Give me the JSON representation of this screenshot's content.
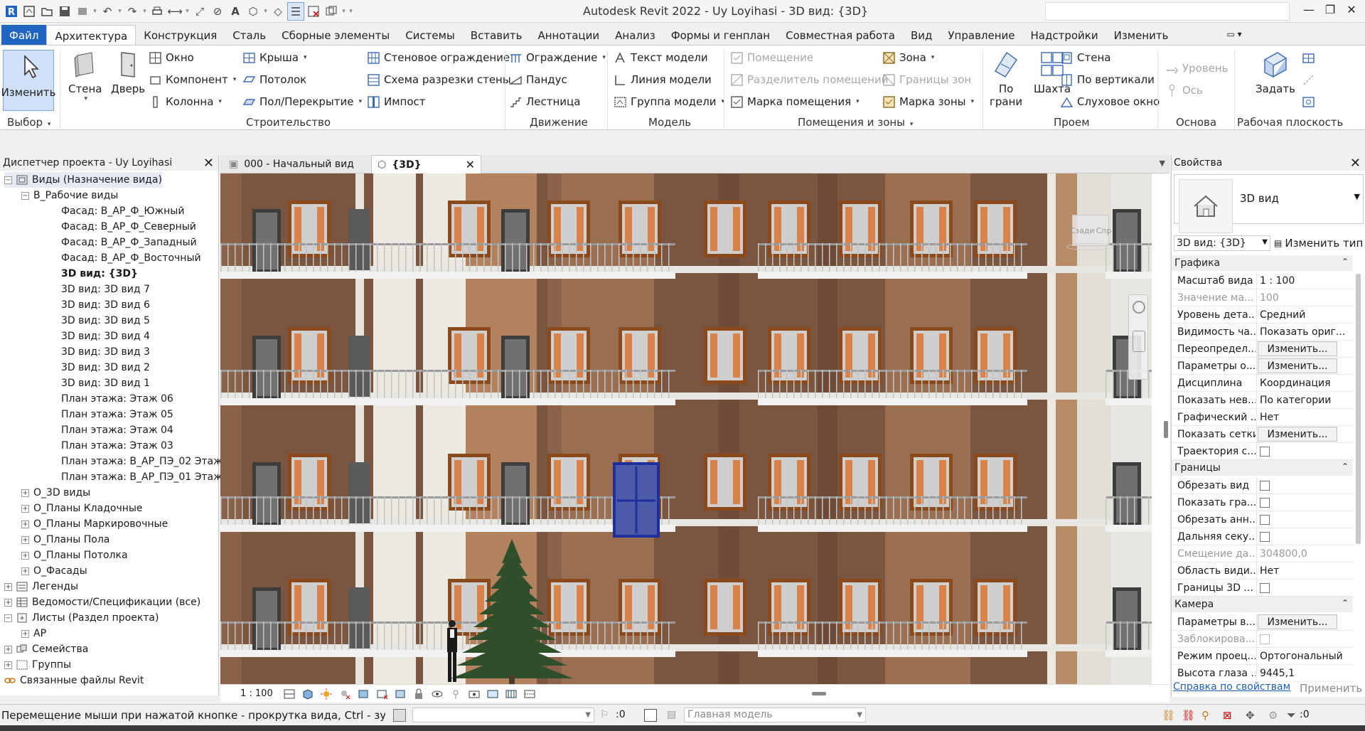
{
  "titlebar": {
    "title": "Autodesk Revit 2022 - Uy Loyihasi - 3D вид: {3D}"
  },
  "ribbon_tabs": [
    "Файл",
    "Архитектура",
    "Конструкция",
    "Сталь",
    "Сборные элементы",
    "Системы",
    "Вставить",
    "Аннотации",
    "Анализ",
    "Формы и генплан",
    "Совместная работа",
    "Вид",
    "Управление",
    "Надстройки",
    "Изменить"
  ],
  "ribbon": {
    "modify": "Изменить",
    "wall": "Стена",
    "door": "Дверь",
    "window": "Окно",
    "component": "Компонент",
    "column": "Колонна",
    "roof": "Крыша",
    "ceiling": "Потолок",
    "floor": "Пол/Перекрытие",
    "curtain_wall": "Стеновое ограждение",
    "curtain_grid": "Схема разрезки стены",
    "mullion": "Импост",
    "railing": "Ограждение",
    "ramp": "Пандус",
    "stair": "Лестница",
    "model_text": "Текст модели",
    "model_line": "Линия  модели",
    "model_group": "Группа модели",
    "room": "Помещение",
    "room_separator": "Разделитель помещений",
    "room_tag": "Марка помещения",
    "area": "Зона",
    "area_boundary": "Границы  зон",
    "area_tag": "Марка  зоны",
    "by_face": "По\nграни",
    "shaft": "Шахта",
    "opening_wall": "Стена",
    "vertical": "По вертикали",
    "dormer": "Слуховое окно",
    "level": "Уровень",
    "grid": "Ось",
    "set": "Задать",
    "panels": {
      "select": "Выбор",
      "build": "Строительство",
      "circulation": "Движение",
      "model": "Модель",
      "room_area": "Помещения и зоны",
      "opening": "Проем",
      "datum": "Основа",
      "work_plane": "Рабочая плоскость"
    }
  },
  "project_browser": {
    "title": "Диспетчер проекта - Uy Loyihasi",
    "items": [
      {
        "label": "Виды (Назначение вида)",
        "level": 0,
        "toggle": "−",
        "icon": "views"
      },
      {
        "label": "В_Рабочие виды",
        "level": 1,
        "toggle": "−"
      },
      {
        "label": "Фасад: В_АР_Ф_Южный",
        "level": 2
      },
      {
        "label": "Фасад: В_АР_Ф_Северный",
        "level": 2
      },
      {
        "label": "Фасад: В_АР_Ф_Западный",
        "level": 2
      },
      {
        "label": "Фасад: В_АР_Ф_Восточный",
        "level": 2
      },
      {
        "label": "3D вид: {3D}",
        "level": 2,
        "bold": true
      },
      {
        "label": "3D вид: 3D вид 7",
        "level": 2
      },
      {
        "label": "3D вид: 3D вид 6",
        "level": 2
      },
      {
        "label": "3D вид: 3D вид 5",
        "level": 2
      },
      {
        "label": "3D вид: 3D вид 4",
        "level": 2
      },
      {
        "label": "3D вид: 3D вид 3",
        "level": 2
      },
      {
        "label": "3D вид: 3D вид 2",
        "level": 2
      },
      {
        "label": "3D вид: 3D вид 1",
        "level": 2
      },
      {
        "label": "План этажа: Этаж 06",
        "level": 2
      },
      {
        "label": "План этажа: Этаж 05",
        "level": 2
      },
      {
        "label": "План этажа: Этаж 04",
        "level": 2
      },
      {
        "label": "План этажа: Этаж 03",
        "level": 2
      },
      {
        "label": "План этажа: В_АР_ПЭ_02 Этаж",
        "level": 2
      },
      {
        "label": "План этажа: В_АР_ПЭ_01 Этаж",
        "level": 2
      },
      {
        "label": "О_3D виды",
        "level": 1,
        "toggle": "+"
      },
      {
        "label": "О_Планы Кладочные",
        "level": 1,
        "toggle": "+"
      },
      {
        "label": "О_Планы Маркировочные",
        "level": 1,
        "toggle": "+"
      },
      {
        "label": "О_Планы Пола",
        "level": 1,
        "toggle": "+"
      },
      {
        "label": "О_Планы Потолка",
        "level": 1,
        "toggle": "+"
      },
      {
        "label": "О_Фасады",
        "level": 1,
        "toggle": "+"
      },
      {
        "label": "Легенды",
        "level": 0,
        "toggle": "+",
        "icon": "legend"
      },
      {
        "label": "Ведомости/Спецификации (все)",
        "level": 0,
        "toggle": "+",
        "icon": "schedule"
      },
      {
        "label": "Листы (Раздел проекта)",
        "level": 0,
        "toggle": "−",
        "icon": "sheet"
      },
      {
        "label": "АР",
        "level": 1,
        "toggle": "+"
      },
      {
        "label": "Семейства",
        "level": 0,
        "toggle": "+",
        "icon": "family"
      },
      {
        "label": "Группы",
        "level": 0,
        "toggle": "+",
        "icon": "group"
      },
      {
        "label": "Связанные файлы Revit",
        "level": 0,
        "icon": "link"
      }
    ]
  },
  "view_tabs": [
    {
      "label": "000 - Начальный вид"
    },
    {
      "label": "{3D}"
    }
  ],
  "viewcube": {
    "face1": "Сзади",
    "face2": "Спр"
  },
  "view_control": {
    "scale": "1 : 100"
  },
  "properties": {
    "title": "Свойства",
    "type_name": "3D вид",
    "instance": "3D вид: {3D}",
    "edit_type": "Изменить тип",
    "groups": {
      "graphics": "Графика",
      "extents": "Границы",
      "camera": "Камера"
    },
    "rows_graphics": [
      {
        "key": "Масштаб вида",
        "value": "1 : 100"
      },
      {
        "key": "Значение ма...",
        "value": "100",
        "disabled": true
      },
      {
        "key": "Уровень дета...",
        "value": "Средний"
      },
      {
        "key": "Видимость ча...",
        "value": "Показать ориг..."
      },
      {
        "key": "Переопредел...",
        "button": "Изменить..."
      },
      {
        "key": "Параметры о...",
        "button": "Изменить..."
      },
      {
        "key": "Дисциплина",
        "value": "Координация"
      },
      {
        "key": "Показать нев...",
        "value": "По категории"
      },
      {
        "key": "Графический ...",
        "value": "Нет"
      },
      {
        "key": "Показать сетки",
        "button": "Изменить..."
      },
      {
        "key": "Траектория с...",
        "checkbox": true
      }
    ],
    "rows_extents": [
      {
        "key": "Обрезать вид",
        "checkbox": true
      },
      {
        "key": "Показать гра...",
        "checkbox": true
      },
      {
        "key": "Обрезать анн...",
        "checkbox": true
      },
      {
        "key": "Дальняя секу...",
        "checkbox": true
      },
      {
        "key": "Смещение да...",
        "value": "304800,0",
        "disabled": true
      },
      {
        "key": "Область види...",
        "value": "Нет"
      },
      {
        "key": "Границы 3D ...",
        "checkbox": true
      }
    ],
    "rows_camera": [
      {
        "key": "Параметры в...",
        "button": "Изменить..."
      },
      {
        "key": "Заблокирова...",
        "checkbox": true,
        "disabled": true
      },
      {
        "key": "Режим проец...",
        "value": "Ортогональный"
      },
      {
        "key": "Высота глаза ...",
        "value": "9445,1"
      }
    ],
    "help": "Справка по свойствам",
    "apply": "Применить"
  },
  "statusbar": {
    "text": "Перемещение мыши при нажатой кнопке - прокрутка вида, Ctrl - зумирован",
    "worksets_count": ":0",
    "design_option": "Главная модель",
    "filter_count": ":0"
  },
  "colors": {
    "accent": "#1f64c1",
    "facade_dark": "#7a5640",
    "facade_mid": "#9a6e50",
    "facade_light": "#b2825e",
    "window_frame": "#8b4a1c",
    "selection": "#1e2f9c",
    "tree": "#2f4f2a"
  }
}
